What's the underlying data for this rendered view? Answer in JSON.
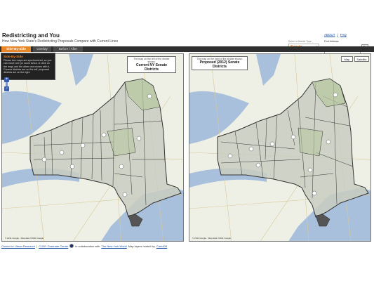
{
  "header": {
    "title": "Redistricting and You",
    "subtitle": "How New York State's Redistricting Proposals Compare with Current Lines",
    "about_label": "ABOUT",
    "faq_label": "FAQ"
  },
  "district_type": {
    "label": "Select a District Type",
    "value": "Senate"
  },
  "find_address": {
    "label": "Find Address:",
    "value": "",
    "go_label": "Go"
  },
  "tabs": [
    {
      "label": "Side-By-Side",
      "active": true
    },
    {
      "label": "Overlay",
      "active": false
    },
    {
      "label": "Before / After",
      "active": false
    }
  ],
  "info_box": {
    "title": "Side-By-Side",
    "text": "Please two maps are synchronized, so you can move one (or zoom in/out, or click on the map) and the other one moves with it. Current districts are on the left, proposed districts are on the right."
  },
  "left_map": {
    "caption_small": "The map on the left of the divider shows:",
    "caption_big": "Current NY Senate Districts",
    "copyright": "© 2011 Google · Map data ©2011 Google"
  },
  "right_map": {
    "caption_small": "The map on the right of the divider shows:",
    "caption_big": "Proposed (2012) Senate Districts",
    "copyright": "© 2011 Google · Map data ©2011 Google",
    "map_button": "Map",
    "satellite_button": "Satellite"
  },
  "footer": {
    "link1": "Center for Urban Research",
    "sep1": "|",
    "link2": "CUNY Graduate Center",
    "text1": "in collaboration with",
    "link3": "The New York World",
    "text2": "Map layers hosted by",
    "link4": "CartoDB"
  },
  "colors": {
    "accent": "#e8862a",
    "tabbar": "#2f2f2f",
    "link": "#1a4da0",
    "water": "#a9c0dc",
    "land": "#eef0e6",
    "district_fill": "#c9cdc0"
  }
}
